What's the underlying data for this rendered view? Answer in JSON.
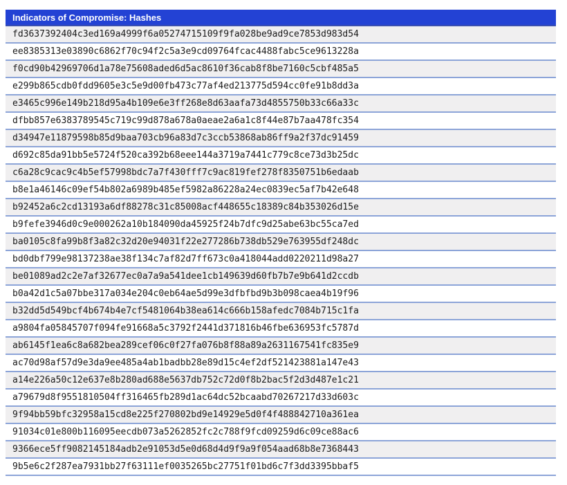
{
  "table": {
    "title": "Indicators of Compromise: Hashes",
    "rows": [
      "fd3637392404c3ed169a4999f6a05274715109f9fa028be9ad9ce7853d983d54",
      "ee8385313e03890c6862f70c94f2c5a3e9cd09764fcac4488fabc5ce9613228a",
      "f0cd90b42969706d1a78e75608aded6d5ac8610f36cab8f8be7160c5cbf485a5",
      "e299b865cdb0fdd9605e3c5e9d00fb473c77af4ed213775d594cc0fe91b8dd3a",
      "e3465c996e149b218d95a4b109e6e3ff268e8d63aafa73d4855750b33c66a33c",
      "dfbb857e6383789545c719c99d878a678a0aeae2a6a1c8f44e87b7aa478fc354",
      "d34947e11879598b85d9baa703cb96a83d7c3ccb53868ab86ff9a2f37dc91459",
      "d692c85da91bb5e5724f520ca392b68eee144a3719a7441c779c8ce73d3b25dc",
      "c6a28c9cac9c4b5ef57998bdc7a7f430fff7c9ac819fef278f8350751b6edaab",
      "b8e1a46146c09ef54b802a6989b485ef5982a86228a24ec0839ec5af7b42e648",
      "b92452a6c2cd13193a6df88278c31c85008acf448655c18389c84b353026d15e",
      "b9fefe3946d0c9e000262a10b184090da45925f24b7dfc9d25abe63bc55ca7ed",
      "ba0105c8fa99b8f3a82c32d20e94031f22e277286b738db529e763955df248dc",
      "bd0dbf799e98137238ae38f134c7af82d7ff673c0a418044add0220211d98a27",
      "be01089ad2c2e7af32677ec0a7a9a541dee1cb149639d60fb7b7e9b641d2ccdb",
      "b0a42d1c5a07bbe317a034e204c0eb64ae5d99e3dfbfbd9b3b098caea4b19f96",
      "b32dd5d549bcf4b674b4e7cf5481064b38ea614c666b158afedc7084b715c1fa",
      "a9804fa05845707f094fe91668a5c3792f2441d371816b46fbe636953fc5787d",
      "ab6145f1ea6c8a682bea289cef06c0f27fa076b8f88a89a2631167541fc835e9",
      "ac70d98af57d9e3da9ee485a4ab1badbb28e89d15c4ef2df521423881a147e43",
      "a14e226a50c12e637e8b280ad688e5637db752c72d0f8b2bac5f2d3d487e1c21",
      "a79679d8f9551810504ff316465fb289d1ac64dc52bcaabd70267217d33d603c",
      "9f94bb59bfc32958a15cd8e225f270802bd9e14929e5d0f4f488842710a361ea",
      "91034c01e800b116095eecdb073a5262852fc2c788f9fcd09259d6c09ce88ac6",
      "9366ece5ff9082145184adb2e91053d5e0d68d4d9f9a9f054aad68b8e7368443",
      "9b5e6c2f287ea7931bb27f63111ef0035265bc27751f01bd6c7f3dd3395bbaf5"
    ]
  },
  "colors": {
    "header_bg": "#2342d4",
    "header_text": "#ffffff",
    "header_border": "#3a4fb0",
    "row_border": "#8ca4d8",
    "row_alt_bg": "#f0eff0",
    "row_bg": "#ffffff",
    "row_text": "#1b1b1b"
  }
}
